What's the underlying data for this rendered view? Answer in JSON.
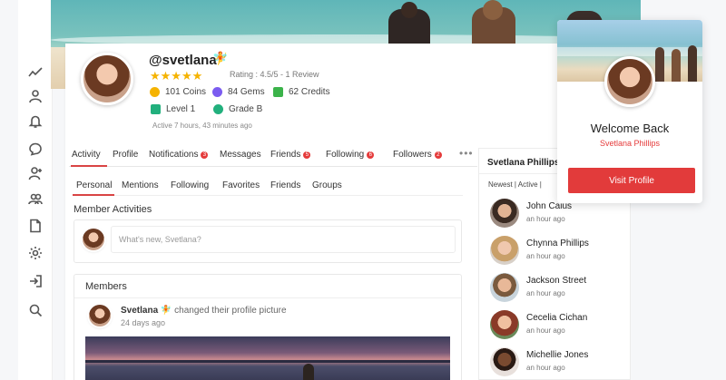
{
  "profile": {
    "username": "@svetlana",
    "fairy_emoji": "🧚",
    "stars": "★★★★★",
    "rating_text": "Rating : 4.5/5 - 1 Review",
    "rating_value": 4.5,
    "coins": "101 Coins",
    "gems": "84 Gems",
    "credits": "62 Credits",
    "level": "Level 1",
    "grade": "Grade B",
    "active": "Active 7 hours, 43 minutes ago",
    "colors": {
      "coins": "#f5b301",
      "gems": "#7b5cf0",
      "credits": "#3bb34a",
      "level": "#22b07d",
      "grade": "#22b07d"
    }
  },
  "tabs": [
    {
      "label": "Activity",
      "badge": ""
    },
    {
      "label": "Profile",
      "badge": ""
    },
    {
      "label": "Notifications",
      "badge": "3"
    },
    {
      "label": "Messages",
      "badge": ""
    },
    {
      "label": "Friends",
      "badge": "5"
    },
    {
      "label": "Following",
      "badge": "6"
    },
    {
      "label": "Followers",
      "badge": "2"
    }
  ],
  "more": "•••",
  "subtabs": [
    "Personal",
    "Mentions",
    "Following",
    "Favorites",
    "Friends",
    "Groups"
  ],
  "member_activities": {
    "title": "Member Activities",
    "placeholder": "What's new, Svetlana?"
  },
  "members": {
    "title": "Members",
    "post_author": "Svetlana",
    "post_emoji": "🧚",
    "post_action": "changed their profile picture",
    "post_time": "24 days ago"
  },
  "right_column": {
    "title": "Svetlana Phillips",
    "filter": "Newest  |  Active  |",
    "members": [
      {
        "name": "John Caius",
        "time": "an hour ago"
      },
      {
        "name": "Chynna Phillips",
        "time": "an hour ago"
      },
      {
        "name": "Jackson Street",
        "time": "an hour ago"
      },
      {
        "name": "Cecelia Cichan",
        "time": "an hour ago"
      },
      {
        "name": "Michellie Jones",
        "time": "an hour ago"
      }
    ]
  },
  "welcome": {
    "title": "Welcome Back",
    "name": "Svetlana Phillips",
    "button": "Visit Profile"
  },
  "accent_color": "#e23b3b"
}
